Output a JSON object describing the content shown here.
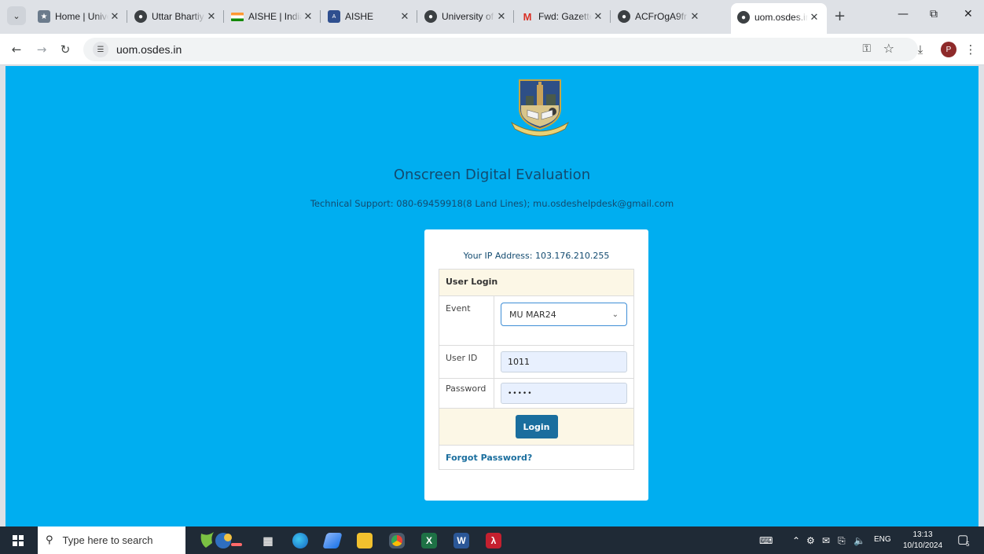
{
  "browser": {
    "tabs": [
      {
        "title": "Home | Unive",
        "icon": "university-favicon"
      },
      {
        "title": "Uttar Bhartiy",
        "icon": "globe-icon"
      },
      {
        "title": "AISHE | India",
        "icon": "india-flag-icon"
      },
      {
        "title": "AISHE",
        "icon": "aishe-favicon"
      },
      {
        "title": "University of",
        "icon": "globe-icon"
      },
      {
        "title": "Fwd: Gazette",
        "icon": "gmail-icon"
      },
      {
        "title": "ACFrOgA9fr",
        "icon": "globe-icon"
      },
      {
        "title": "uom.osdes.in",
        "icon": "globe-icon",
        "active": true
      }
    ],
    "url": "uom.osdes.in",
    "profile_initial": "P"
  },
  "page": {
    "title": "Onscreen Digital Evaluation",
    "support": "Technical Support: 080-69459918(8 Land Lines); mu.osdeshelpdesk@gmail.com",
    "login": {
      "ip_text": "Your IP Address: 103.176.210.255",
      "header": "User Login",
      "event_label": "Event",
      "event_value": "MU MAR24",
      "userid_label": "User ID",
      "userid_value": "1011",
      "password_label": "Password",
      "password_value": "•••••",
      "login_button": "Login",
      "forgot_link": "Forgot Password?"
    }
  },
  "taskbar": {
    "search_placeholder": "Type here to search",
    "language": "ENG",
    "time": "13:13",
    "date": "10/10/2024",
    "notification_count": "5"
  },
  "colors": {
    "page_background": "#00aef0",
    "heading_text": "#134b70",
    "button": "#1a6e9e",
    "table_header": "#fcf7e6"
  }
}
